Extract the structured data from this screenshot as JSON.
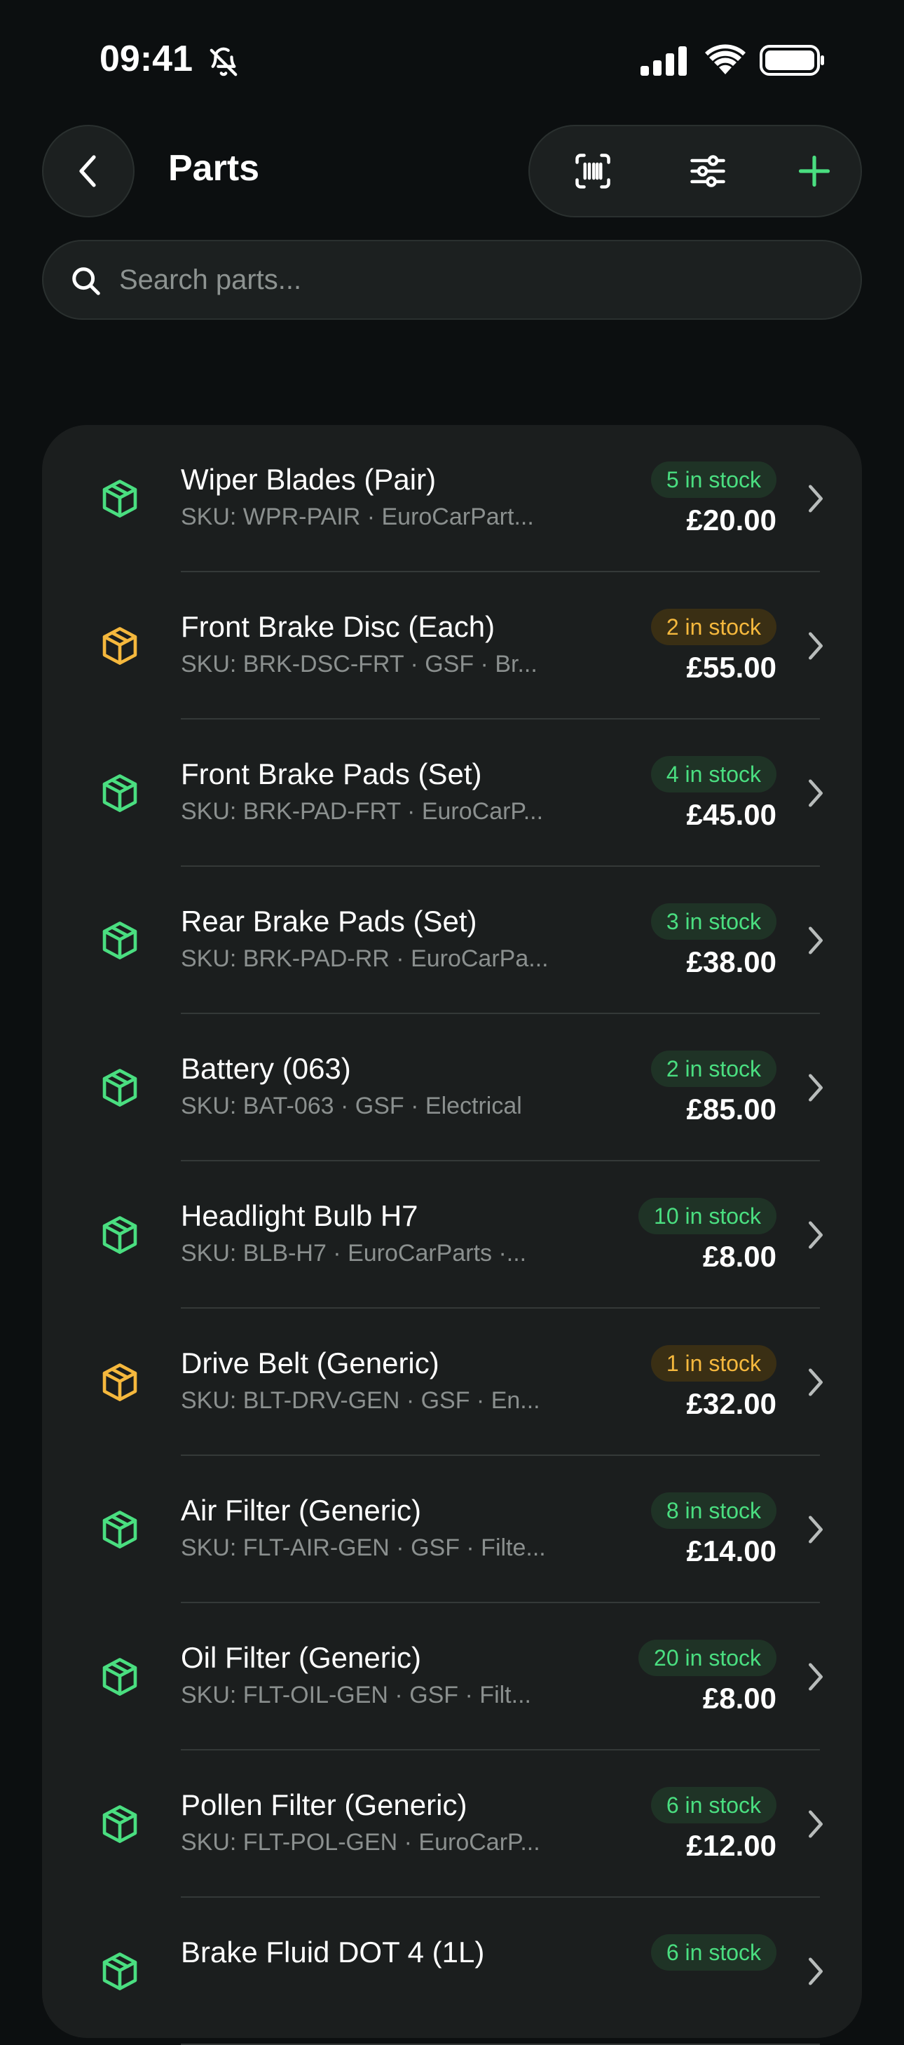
{
  "status_bar": {
    "time": "09:41",
    "icons": [
      "bell-slash-icon",
      "cellular-signal-icon",
      "wifi-icon",
      "battery-icon"
    ]
  },
  "header": {
    "title": "Parts",
    "back_icon": "chevron-left-icon",
    "actions": [
      "barcode-scan-icon",
      "filter-sliders-icon",
      "plus-icon"
    ]
  },
  "search": {
    "placeholder": "Search parts...",
    "value": ""
  },
  "colors": {
    "in_stock": "#4ade80",
    "low_stock": "#f5b83d",
    "background": "#0c0f10",
    "card": "#1b1e1e"
  },
  "parts": [
    {
      "name": "Wiper Blades (Pair)",
      "sub": "SKU: WPR-PAIR · EuroCarPart...",
      "stock": "5 in stock",
      "price": "£20.00",
      "status": "green",
      "icon": "package-icon"
    },
    {
      "name": "Front Brake Disc (Each)",
      "sub": "SKU: BRK-DSC-FRT · GSF · Br...",
      "stock": "2 in stock",
      "price": "£55.00",
      "status": "amber",
      "icon": "package-icon"
    },
    {
      "name": "Front Brake Pads (Set)",
      "sub": "SKU: BRK-PAD-FRT · EuroCarP...",
      "stock": "4 in stock",
      "price": "£45.00",
      "status": "green",
      "icon": "package-icon"
    },
    {
      "name": "Rear Brake Pads (Set)",
      "sub": "SKU: BRK-PAD-RR · EuroCarPa...",
      "stock": "3 in stock",
      "price": "£38.00",
      "status": "green",
      "icon": "package-icon"
    },
    {
      "name": "Battery (063)",
      "sub": "SKU: BAT-063 · GSF · Electrical",
      "stock": "2 in stock",
      "price": "£85.00",
      "status": "green",
      "icon": "package-icon"
    },
    {
      "name": "Headlight Bulb H7",
      "sub": "SKU: BLB-H7 · EuroCarParts ·...",
      "stock": "10 in stock",
      "price": "£8.00",
      "status": "green",
      "icon": "package-icon"
    },
    {
      "name": "Drive Belt (Generic)",
      "sub": "SKU: BLT-DRV-GEN · GSF · En...",
      "stock": "1 in stock",
      "price": "£32.00",
      "status": "amber",
      "icon": "package-icon"
    },
    {
      "name": "Air Filter (Generic)",
      "sub": "SKU: FLT-AIR-GEN · GSF · Filte...",
      "stock": "8 in stock",
      "price": "£14.00",
      "status": "green",
      "icon": "package-icon"
    },
    {
      "name": "Oil Filter (Generic)",
      "sub": "SKU: FLT-OIL-GEN · GSF · Filt...",
      "stock": "20 in stock",
      "price": "£8.00",
      "status": "green",
      "icon": "package-icon"
    },
    {
      "name": "Pollen Filter (Generic)",
      "sub": "SKU: FLT-POL-GEN · EuroCarP...",
      "stock": "6 in stock",
      "price": "£12.00",
      "status": "green",
      "icon": "package-icon"
    },
    {
      "name": "Brake Fluid DOT 4 (1L)",
      "sub": "",
      "stock": "6 in stock",
      "price": "",
      "status": "green",
      "icon": "package-icon"
    }
  ]
}
